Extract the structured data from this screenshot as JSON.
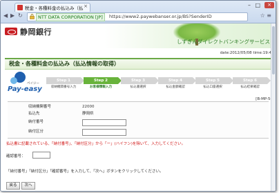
{
  "tab": {
    "title": "税金・各種料金の払込み（払"
  },
  "address": {
    "ssl_label": "NTT DATA CORPORATION [JP]",
    "url": "https://www2.paywebanser.or.jp/BS?SenderID"
  },
  "bank": {
    "name": "静岡銀行",
    "tagline": "しずぎんダイレクトバンキングサービス"
  },
  "date": "date:2012/05/08 time:19:4",
  "header_title": "税金・各種料金の払込み（払込情報の取得）",
  "payeasy": {
    "text": "Pay-easy",
    "kana": "ペイジー"
  },
  "steps": [
    {
      "num": "Step 1",
      "name": "収納機関番号入力"
    },
    {
      "num": "Step 2",
      "name": "お客様情報入力"
    },
    {
      "num": "Step 3",
      "name": "払込書選択"
    },
    {
      "num": "Step 4",
      "name": "払込金額確認"
    },
    {
      "num": "Step 5",
      "name": "払込口座選択"
    },
    {
      "num": "Step 6",
      "name": "払込結果確認"
    }
  ],
  "code": "[B-MP-50",
  "form": {
    "rows": [
      {
        "label": "収納機関番号",
        "value": "22000"
      },
      {
        "label": "払込先",
        "value": "静岡県"
      },
      {
        "label": "納付番号",
        "value": ""
      },
      {
        "label": "納付区分",
        "value": ""
      }
    ]
  },
  "warning": "払込書に記載されている、「納付番号」、「納付区分」から「ー」(ハイフン)を除いて、入力してください。",
  "confirm_label": "確認番号：",
  "instruction": "「納付番号」「納付区分」「確認番号」を入力して、「次へ」ボタンをクリックしてください。",
  "buttons": {
    "back": "戻る",
    "next": "次へ"
  }
}
